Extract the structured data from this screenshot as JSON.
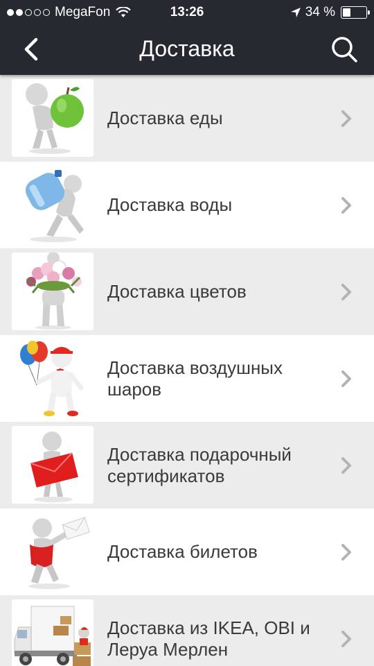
{
  "status_bar": {
    "carrier": "MegaFon",
    "time": "13:26",
    "battery_percent": "34 %",
    "battery_level": 0.34,
    "signal_bars_filled": 2,
    "signal_bars_total": 5
  },
  "nav": {
    "title": "Доставка",
    "back_icon": "chevron-left-icon",
    "search_icon": "search-icon"
  },
  "items": [
    {
      "label": "Доставка еды",
      "icon": "apple-carrier-figure"
    },
    {
      "label": "Доставка воды",
      "icon": "water-bottle-carrier-figure"
    },
    {
      "label": "Доставка цветов",
      "icon": "flower-bouquet-figure"
    },
    {
      "label": "Доставка воздушных шаров",
      "icon": "balloon-figure"
    },
    {
      "label": "Доставка подарочный сертификатов",
      "icon": "envelope-figure"
    },
    {
      "label": "Доставка билетов",
      "icon": "letter-bag-figure"
    },
    {
      "label": "Доставка из IKEA, OBI и Леруа Мерлен",
      "icon": "delivery-truck-figure"
    }
  ],
  "colors": {
    "header_bg": "#262a30",
    "row_alt_bg": "#ececec",
    "chevron": "#b3b3b3"
  }
}
